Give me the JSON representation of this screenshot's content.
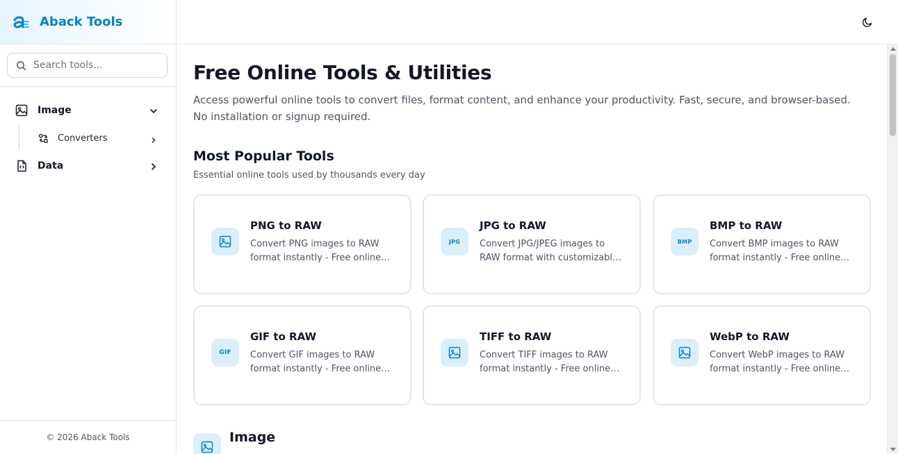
{
  "brand": {
    "name": "Aback Tools",
    "logo_icon": "aback-logo-icon"
  },
  "search": {
    "placeholder": "Search tools..."
  },
  "sidebar": {
    "items": [
      {
        "label": "Image",
        "icon": "image-icon",
        "expanded": true
      },
      {
        "label": "Converters",
        "icon": "converters-icon"
      },
      {
        "label": "Data",
        "icon": "data-file-icon",
        "expanded": false
      }
    ],
    "footer": "© 2026 Aback Tools"
  },
  "topbar": {
    "theme_icon": "moon-icon"
  },
  "hero": {
    "title": "Free Online Tools & Utilities",
    "description": "Access powerful online tools to convert files, format content, and enhance your productivity. Fast, secure, and browser-based. No installation or signup required."
  },
  "popular": {
    "title": "Most Popular Tools",
    "subtitle": "Essential online tools used by thousands every day",
    "cards": [
      {
        "title": "PNG to RAW",
        "desc": "Convert PNG images to RAW format instantly - Free online converter",
        "icon": "image-icon",
        "icon_text": ""
      },
      {
        "title": "JPG to RAW",
        "desc": "Convert JPG/JPEG images to RAW format with customizable options",
        "icon": "jpg-file-icon",
        "icon_text": "JPG"
      },
      {
        "title": "BMP to RAW",
        "desc": "Convert BMP images to RAW format instantly - Free online converter",
        "icon": "bmp-file-icon",
        "icon_text": "BMP"
      },
      {
        "title": "GIF to RAW",
        "desc": "Convert GIF images to RAW format instantly - Free online converter",
        "icon": "gif-icon",
        "icon_text": "GIF"
      },
      {
        "title": "TIFF to RAW",
        "desc": "Convert TIFF images to RAW format instantly - Free online converter",
        "icon": "image-icon",
        "icon_text": ""
      },
      {
        "title": "WebP to RAW",
        "desc": "Convert WebP images to RAW format instantly - Free online converter",
        "icon": "image-icon",
        "icon_text": ""
      }
    ]
  },
  "section": {
    "title": "Image",
    "icon": "image-icon"
  },
  "colors": {
    "accent": "#0284c7",
    "icon_bg": "#dbeefc",
    "border": "#e5e7eb"
  }
}
